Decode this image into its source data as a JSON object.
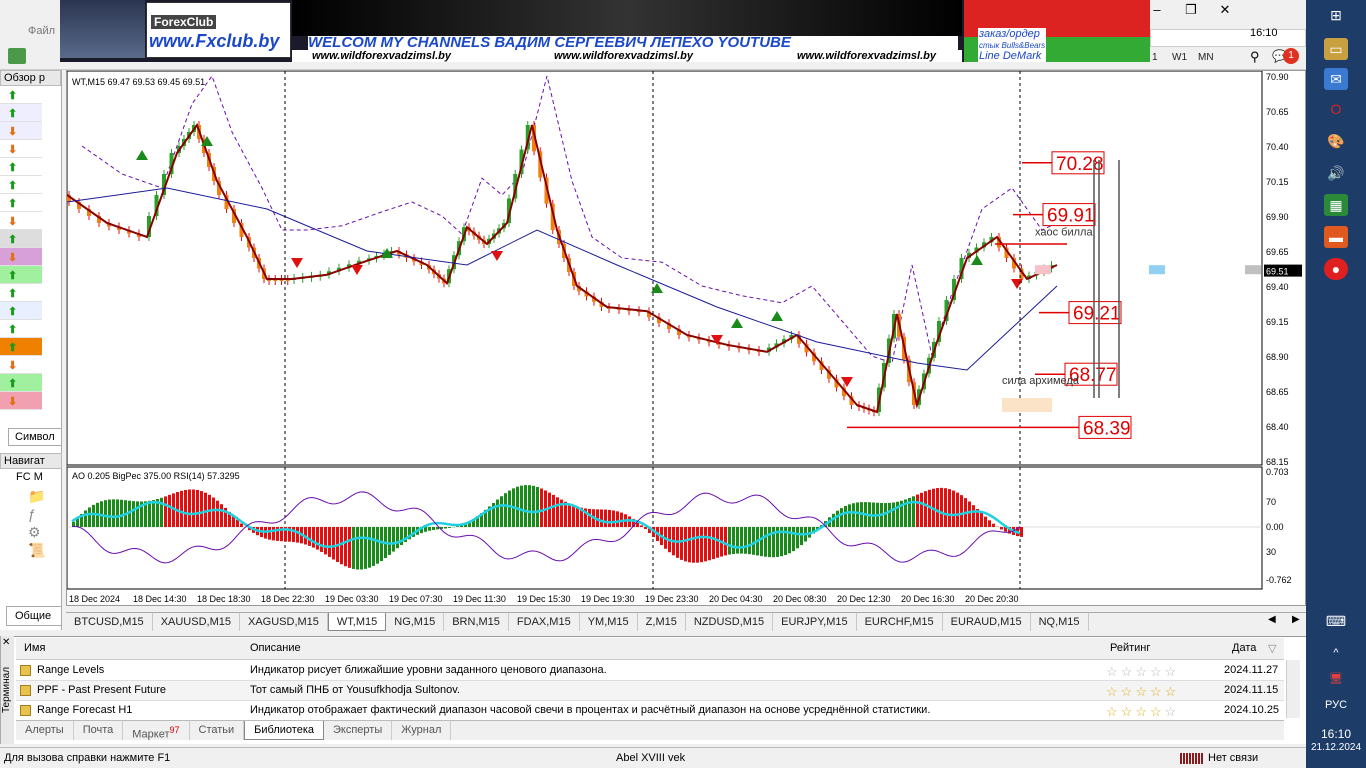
{
  "app": {
    "menu_first": "Файл",
    "nav_first": "Обзор р",
    "symbols_tab": "Символ",
    "navigator": "Навигат",
    "nav_root": "FC M",
    "general_tab": "Общие"
  },
  "banner": {
    "fxclub_top": "ForexClub",
    "fxclub": "www.Fxclub.by",
    "welcome": "WELCOM MY CHANNELS ВАДИМ СЕРГЕЕВИЧ ЛЕПЕХО YOUTUBE",
    "sites": [
      "www.wildforexvadzimsl.by",
      "www.wildforexvadzimsl.by",
      "www.wildforexvadzimsl.by"
    ],
    "order": "заказ/ордер",
    "bulls": "стык Bulls&Bears",
    "demark": "Line DeMark"
  },
  "timeframes": [
    "1",
    "W1",
    "MN"
  ],
  "chart": {
    "header": "WT,M15  69.47 69.53 69.45 69.51",
    "price_axis": [
      "70.90",
      "70.65",
      "70.40",
      "70.15",
      "69.90",
      "69.65",
      "69.51",
      "69.40",
      "69.15",
      "68.90",
      "68.65",
      "68.40",
      "68.15"
    ],
    "current_price": "69.51",
    "levels": [
      "70.28",
      "69.91",
      "69.21",
      "68.77",
      "68.39"
    ],
    "annot_chaos": "хаос билла",
    "annot_arch": "сила архимеда",
    "sub_header": "AO 0.205  BigPec 375.00  RSI(14) 57.3295",
    "sub_axis": [
      "0.703",
      "70",
      "0.00",
      "30",
      "-0.762"
    ],
    "time_axis": [
      "18 Dec 2024",
      "18 Dec 14:30",
      "18 Dec 18:30",
      "18 Dec 22:30",
      "19 Dec 03:30",
      "19 Dec 07:30",
      "19 Dec 11:30",
      "19 Dec 15:30",
      "19 Dec 19:30",
      "19 Dec 23:30",
      "20 Dec 04:30",
      "20 Dec 08:30",
      "20 Dec 12:30",
      "20 Dec 16:30",
      "20 Dec 20:30"
    ],
    "colors": {
      "bull": "#2aa02a",
      "bear": "#e01010",
      "ma": "#1a1a9a",
      "ma2": "#8b0000",
      "env": "#6a0dad",
      "rsi": "#20d0e0",
      "level": "#e00000"
    }
  },
  "symbol_tabs": [
    "BTCUSD,M15",
    "XAUUSD,M15",
    "XAGUSD,M15",
    "WT,M15",
    "NG,M15",
    "BRN,M15",
    "FDAX,M15",
    "YM,M15",
    "Z,M15",
    "NZDUSD,M15",
    "EURJPY,M15",
    "EURCHF,M15",
    "EURAUD,M15",
    "NQ,M15"
  ],
  "terminal": {
    "label": "Терминал",
    "columns": {
      "name": "Имя",
      "desc": "Описание",
      "rating": "Рейтинг",
      "date": "Дата"
    },
    "rows": [
      {
        "name": "Range Levels",
        "desc": "Индикатор рисует ближайшие уровни заданного ценового диапазона.",
        "rating": 0,
        "date": "2024.11.27"
      },
      {
        "name": "PPF - Past Present Future",
        "desc": "Тот самый ПНБ от Yousufkhodja Sultonov.",
        "rating": 4.5,
        "date": "2024.11.15"
      },
      {
        "name": "Range Forecast H1",
        "desc": "Индикатор отображает фактический диапазон часовой свечи в процентах и расчётный диапазон на основе усреднённой статистики.",
        "rating": 4,
        "date": "2024.10.25"
      }
    ],
    "tabs": [
      "Алерты",
      "Почта",
      "Маркет",
      "Статьи",
      "Библиотека",
      "Эксперты",
      "Журнал"
    ],
    "market_badge": "97"
  },
  "status": {
    "help": "Для вызова справки нажмите F1",
    "profile": "Abel XVIII vek",
    "conn": "Нет связи"
  },
  "taskbar": {
    "lang": "РУС",
    "time": "16:10",
    "date": "21.12.2024"
  }
}
